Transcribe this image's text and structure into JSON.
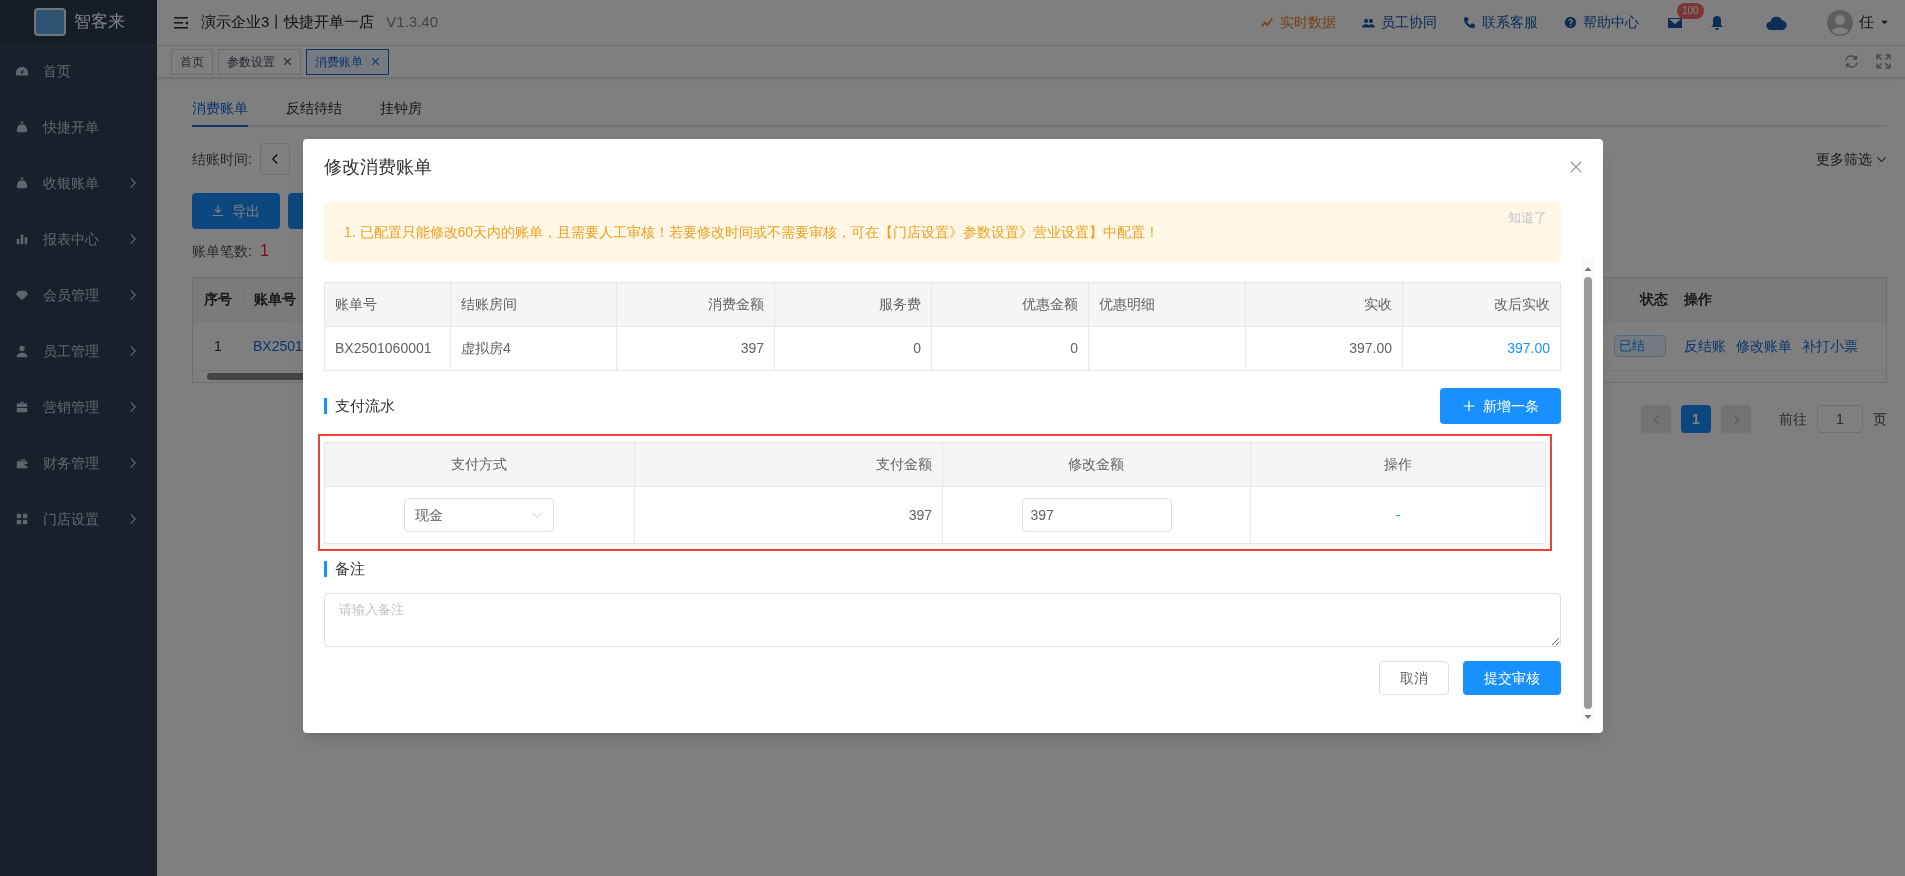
{
  "sidebar": {
    "logo_text": "智客来",
    "items": [
      {
        "label": "首页",
        "expandable": false
      },
      {
        "label": "快捷开单",
        "expandable": false
      },
      {
        "label": "收银账单",
        "expandable": true
      },
      {
        "label": "报表中心",
        "expandable": true
      },
      {
        "label": "会员管理",
        "expandable": true
      },
      {
        "label": "员工管理",
        "expandable": true
      },
      {
        "label": "营销管理",
        "expandable": true
      },
      {
        "label": "财务管理",
        "expandable": true
      },
      {
        "label": "门店设置",
        "expandable": true
      }
    ]
  },
  "header": {
    "title": "演示企业3丨快捷开单一店",
    "version": "V1.3.40",
    "links": [
      {
        "label": "实时数据",
        "kind": "highlight"
      },
      {
        "label": "员工协同",
        "kind": "normal"
      },
      {
        "label": "联系客服",
        "kind": "normal"
      },
      {
        "label": "帮助中心",
        "kind": "normal"
      }
    ],
    "mail_badge": "100",
    "user": "任"
  },
  "page_tabs": [
    {
      "label": "首页",
      "closable": false,
      "selected": false
    },
    {
      "label": "参数设置",
      "closable": true,
      "selected": false
    },
    {
      "label": "消费账单",
      "closable": true,
      "selected": true
    }
  ],
  "content": {
    "tabs": [
      {
        "label": "消费账单",
        "selected": true
      },
      {
        "label": "反结待结",
        "selected": false
      },
      {
        "label": "挂钟房",
        "selected": false
      }
    ],
    "filter_label": "结账时间:",
    "more_filters": "更多筛选",
    "export_button": "导出",
    "count_label": "账单笔数:",
    "count_value": "1",
    "table": {
      "columns": [
        "序号",
        "账单号",
        "状态",
        "操作"
      ],
      "row": {
        "index": "1",
        "bill_no": "BX2501",
        "status": "已结",
        "actions": [
          "反结账",
          "修改账单",
          "补打小票"
        ]
      }
    },
    "pagination": {
      "current": "1",
      "goto_label": "前往",
      "goto_value": "1",
      "page_suffix": "页"
    }
  },
  "modal": {
    "title": "修改消费账单",
    "notice": "1. 已配置只能修改60天内的账单，且需要人工审核！若要修改时间或不需要审核，可在【门店设置》参数设置》营业设置】中配置！",
    "notice_dismiss": "知道了",
    "bill_table": {
      "columns": [
        "账单号",
        "结账房间",
        "消费金额",
        "服务费",
        "优惠金额",
        "优惠明细",
        "实收",
        "改后实收"
      ],
      "row": [
        {
          "text": "BX2501060001",
          "kind": "plain"
        },
        {
          "text": "虚拟房4",
          "kind": "plain"
        },
        {
          "text": "397",
          "kind": "plain"
        },
        {
          "text": "0",
          "kind": "plain"
        },
        {
          "text": "0",
          "kind": "plain"
        },
        {
          "kind": "plain"
        },
        {
          "text": "397.00",
          "kind": "plain"
        },
        {
          "text": "397.00",
          "kind": "link"
        }
      ]
    },
    "payments_title": "支付流水",
    "add_button": "新增一条",
    "payment_table": {
      "columns": [
        "支付方式",
        "支付金额",
        "修改金额",
        "操作"
      ],
      "rows": [
        {
          "method": "现金",
          "amount": "397",
          "new_amount": "397",
          "action": "-"
        }
      ]
    },
    "remark_title": "备注",
    "remark_placeholder": "请输入备注",
    "cancel_button": "取消",
    "submit_button": "提交审核"
  }
}
